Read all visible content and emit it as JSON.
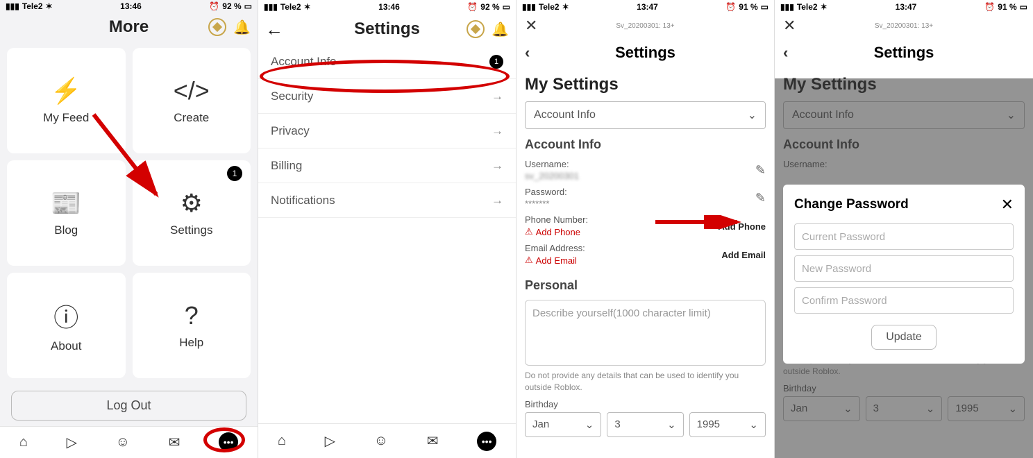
{
  "status1": {
    "carrier": "Tele2",
    "time": "13:46",
    "bat": "92 %"
  },
  "status2": {
    "carrier": "Tele2",
    "time": "13:46",
    "bat": "92 %"
  },
  "status3": {
    "carrier": "Tele2",
    "time": "13:47",
    "bat": "91 %"
  },
  "status4": {
    "carrier": "Tele2",
    "time": "13:47",
    "bat": "91 %"
  },
  "s1": {
    "title": "More",
    "tiles": [
      {
        "label": "My Feed"
      },
      {
        "label": "Create"
      },
      {
        "label": "Blog"
      },
      {
        "label": "Settings",
        "badge": "1"
      },
      {
        "label": "About"
      },
      {
        "label": "Help"
      }
    ],
    "logout": "Log Out"
  },
  "s2": {
    "title": "Settings",
    "rows": [
      {
        "label": "Account Info",
        "badge": "1"
      },
      {
        "label": "Security"
      },
      {
        "label": "Privacy"
      },
      {
        "label": "Billing"
      },
      {
        "label": "Notifications"
      }
    ]
  },
  "s3": {
    "topsmall": "Sv_20200301: 13+",
    "subtitle": "Settings",
    "h1": "My Settings",
    "dropdown": "Account Info",
    "section": "Account Info",
    "username_label": "Username:",
    "username_value": "sv_20200301",
    "password_label": "Password:",
    "password_value": "*******",
    "phone_label": "Phone Number:",
    "phone_warn": "Add Phone",
    "phone_action": "Add Phone",
    "email_label": "Email Address:",
    "email_warn": "Add Email",
    "email_action": "Add Email",
    "personal": "Personal",
    "desc_placeholder": "Describe yourself(1000 character limit)",
    "note": "Do not provide any details that can be used to identify you outside Roblox.",
    "birthday_label": "Birthday",
    "bday": [
      "Jan",
      "3",
      "1995"
    ]
  },
  "s4": {
    "topsmall": "Sv_20200301: 13+",
    "subtitle": "Settings",
    "h1": "My Settings",
    "dropdown": "Account Info",
    "section": "Account Info",
    "username_label": "Username:",
    "note": "Do not provide any details that can be used to identify you outside Roblox.",
    "birthday_label": "Birthday",
    "bday": [
      "Jan",
      "3",
      "1995"
    ],
    "modal": {
      "title": "Change Password",
      "p1": "Current Password",
      "p2": "New Password",
      "p3": "Confirm Password",
      "btn": "Update"
    }
  }
}
